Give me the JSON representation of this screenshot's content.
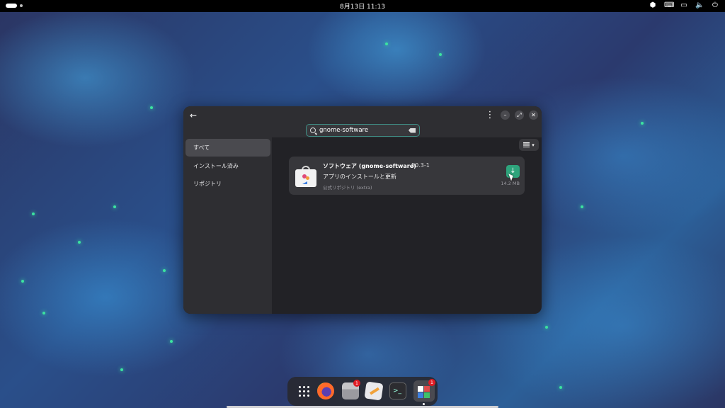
{
  "topbar": {
    "clock": "8月13日  11:13",
    "tray_icons": [
      "privacy-indicator-icon",
      "keyboard-icon",
      "display-icon",
      "volume-icon",
      "power-icon"
    ]
  },
  "window": {
    "search": {
      "value": "gnome-software"
    },
    "sidebar": {
      "items": [
        {
          "label": "すべて",
          "active": true
        },
        {
          "label": "インストール済み",
          "active": false
        },
        {
          "label": "リポジトリ",
          "active": false
        }
      ]
    },
    "result": {
      "name": "ソフトウェア (gnome-software)",
      "version": "50.3-1",
      "description": "アプリのインストールと更新",
      "source": "公式リポジトリ (extra)",
      "size": "14.2 MB",
      "install_icon": "download-arrow-icon"
    }
  },
  "dock": {
    "items": [
      "apps-grid-icon",
      "firefox-icon",
      "files-icon",
      "text-editor-icon",
      "terminal-icon",
      "software-icon"
    ],
    "files_badge": "1",
    "software_badge": "1"
  },
  "colors": {
    "accent": "#2ea47c",
    "search_focus": "#3f8f86",
    "badge": "#e01b24"
  }
}
